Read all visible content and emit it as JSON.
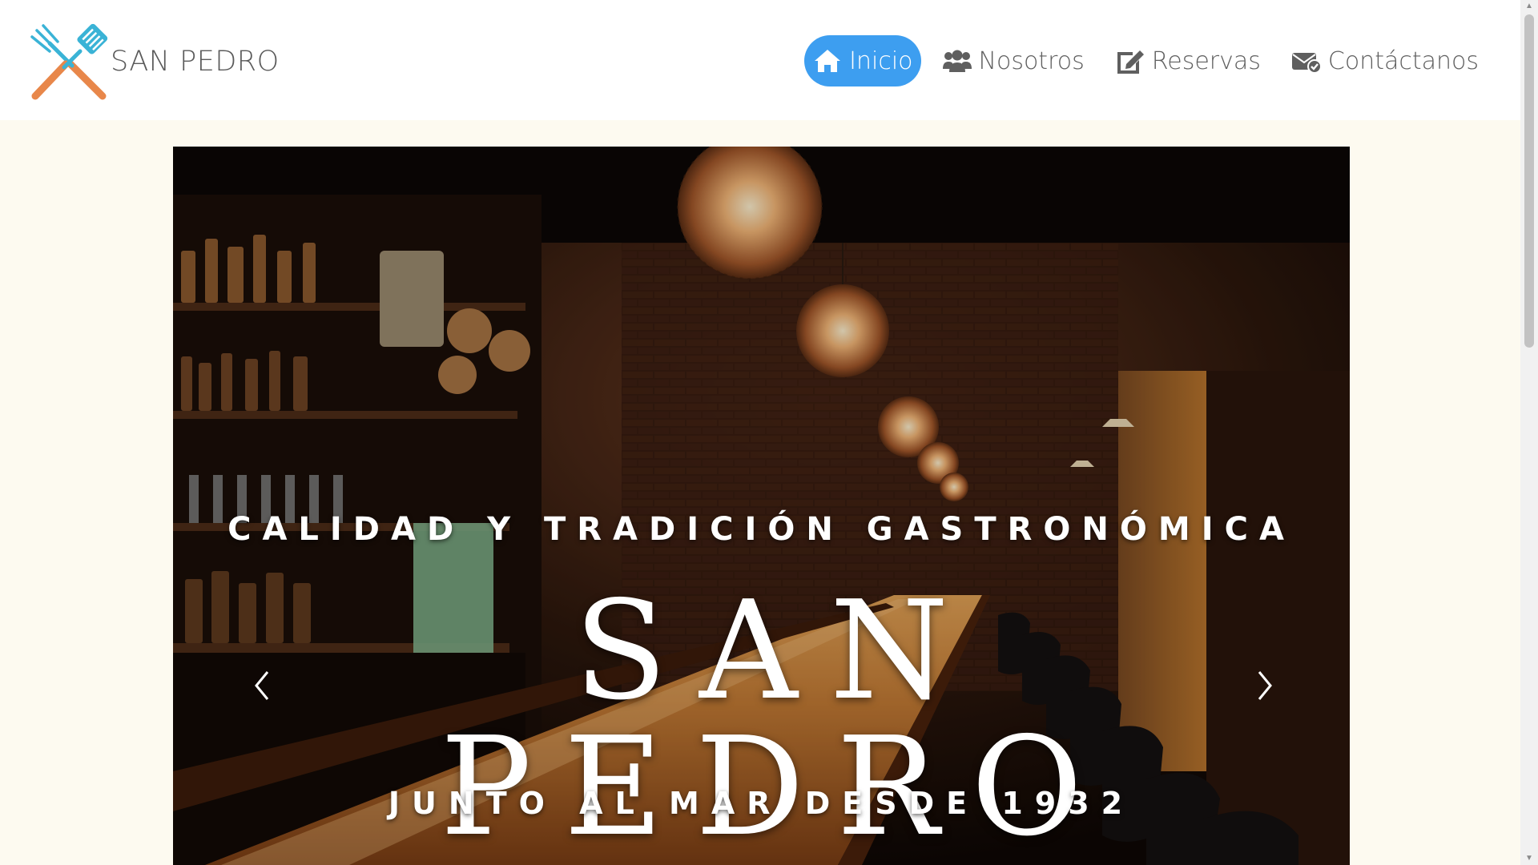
{
  "brand": {
    "name": "SAN PEDRO",
    "logo_icon": "crossed-spatula-fork-icon"
  },
  "nav": {
    "items": [
      {
        "label": "Inicio",
        "icon": "home-icon",
        "active": true
      },
      {
        "label": "Nosotros",
        "icon": "users-icon",
        "active": false
      },
      {
        "label": "Reservas",
        "icon": "edit-icon",
        "active": false
      },
      {
        "label": "Contáctanos",
        "icon": "envelope-check-icon",
        "active": false
      }
    ]
  },
  "hero": {
    "tagline": "CALIDAD Y TRADICIÓN GASTRONÓMICA",
    "title": "SAN PEDRO",
    "subtitle": "JUNTO AL MAR DESDE 1932",
    "prev_icon": "chevron-left-icon",
    "next_icon": "chevron-right-icon"
  },
  "colors": {
    "accent": "#3d9ef0",
    "page_background": "#fdfaf0",
    "nav_text": "#5f5f5f"
  }
}
